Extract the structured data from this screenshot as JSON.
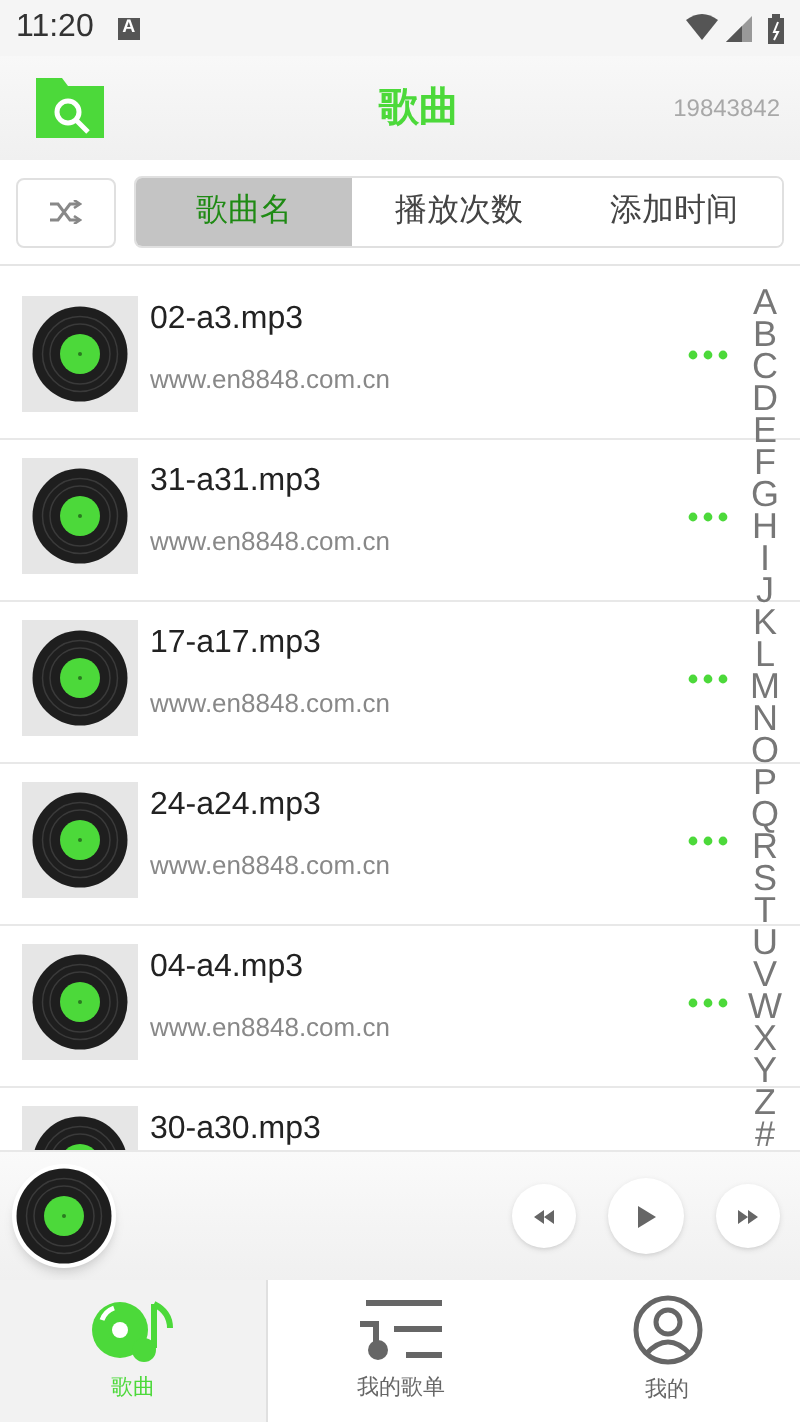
{
  "status_bar": {
    "time": "11:20",
    "badge": "A"
  },
  "header": {
    "title": "歌曲",
    "counter": "19843842"
  },
  "sort_tabs": [
    {
      "label": "歌曲名",
      "selected": true
    },
    {
      "label": "播放次数",
      "selected": false
    },
    {
      "label": "添加时间",
      "selected": false
    }
  ],
  "songs": [
    {
      "title": "02-a3.mp3",
      "subtitle": "www.en8848.com.cn"
    },
    {
      "title": "31-a31.mp3",
      "subtitle": "www.en8848.com.cn"
    },
    {
      "title": "17-a17.mp3",
      "subtitle": "www.en8848.com.cn"
    },
    {
      "title": "24-a24.mp3",
      "subtitle": "www.en8848.com.cn"
    },
    {
      "title": "04-a4.mp3",
      "subtitle": "www.en8848.com.cn"
    },
    {
      "title": "30-a30.mp3"
    }
  ],
  "alphabet_index": [
    "A",
    "B",
    "C",
    "D",
    "E",
    "F",
    "G",
    "H",
    "I",
    "J",
    "K",
    "L",
    "M",
    "N",
    "O",
    "P",
    "Q",
    "R",
    "S",
    "T",
    "U",
    "V",
    "W",
    "X",
    "Y",
    "Z",
    "#"
  ],
  "bottom_nav": [
    {
      "label": "歌曲",
      "kind": "songs",
      "selected": true
    },
    {
      "label": "我的歌单",
      "kind": "playlists",
      "selected": false
    },
    {
      "label": "我的",
      "kind": "profile",
      "selected": false
    }
  ]
}
